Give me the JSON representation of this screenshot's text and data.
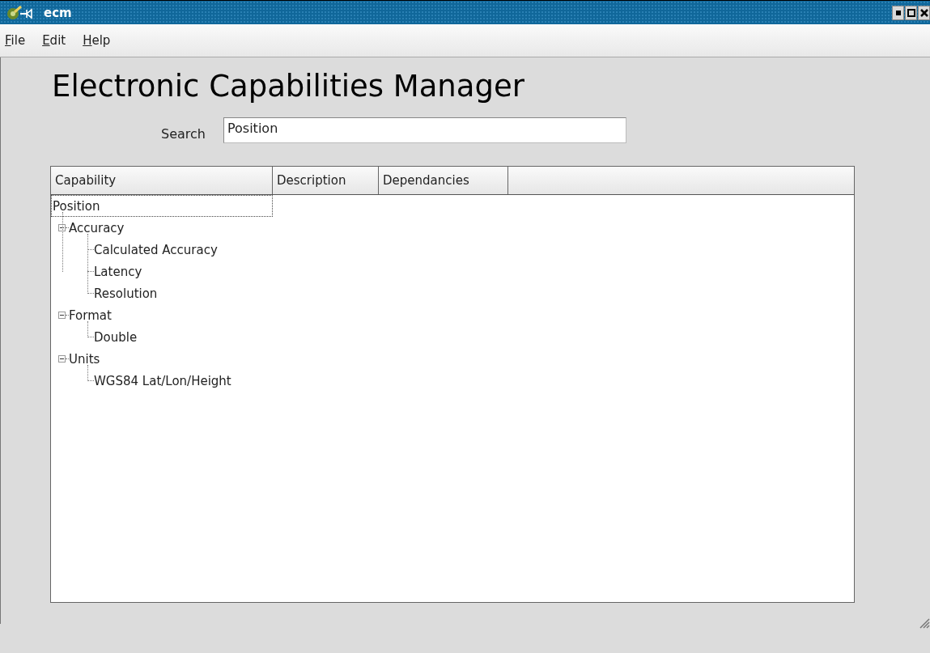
{
  "window": {
    "title": "ecm"
  },
  "menu": [
    {
      "label": "File"
    },
    {
      "label": "Edit"
    },
    {
      "label": "Help"
    }
  ],
  "heading": "Electronic Capabilities Manager",
  "search": {
    "label": "Search",
    "value": "Position"
  },
  "table": {
    "columns": [
      "Capability",
      "Description",
      "Dependancies"
    ],
    "tree": [
      {
        "label": "Position",
        "selected": true,
        "children": [
          {
            "label": "Accuracy",
            "selected": false,
            "expanded": true,
            "children": [
              {
                "label": "Calculated Accuracy",
                "selected": false
              },
              {
                "label": "Latency",
                "selected": false
              },
              {
                "label": "Resolution",
                "selected": false
              }
            ]
          },
          {
            "label": "Format",
            "selected": false,
            "expanded": true,
            "children": [
              {
                "label": "Double",
                "selected": false
              }
            ]
          },
          {
            "label": "Units",
            "selected": false,
            "expanded": true,
            "children": [
              {
                "label": "WGS84 Lat/Lon/Height",
                "selected": false
              }
            ]
          }
        ]
      }
    ]
  }
}
